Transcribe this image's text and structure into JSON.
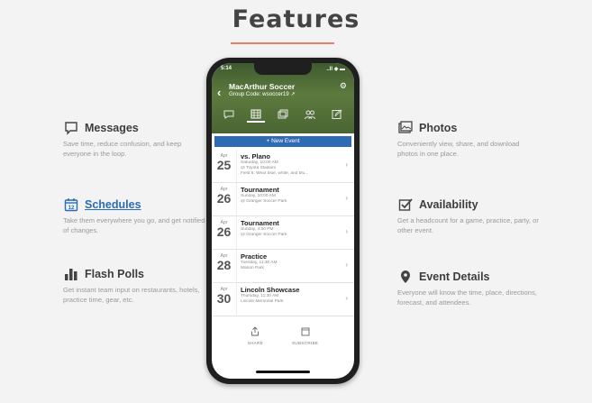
{
  "page": {
    "title": "Features"
  },
  "features_left": [
    {
      "name": "messages",
      "icon": "chat-bubble-icon",
      "label": "Messages",
      "desc": "Save time, reduce confusion, and keep everyone in the loop."
    },
    {
      "name": "schedules",
      "icon": "calendar-icon",
      "label": "Schedules",
      "desc": "Take them everywhere you go, and get notified of changes.",
      "active": true
    },
    {
      "name": "flash-polls",
      "icon": "bar-chart-icon",
      "label": "Flash Polls",
      "desc": "Get instant team input on restaurants, hotels, practice time, gear, etc."
    }
  ],
  "features_right": [
    {
      "name": "photos",
      "icon": "photos-icon",
      "label": "Photos",
      "desc": "Conveniently view, share, and download photos in one place."
    },
    {
      "name": "availability",
      "icon": "checkbox-icon",
      "label": "Availability",
      "desc": "Get a headcount for a game, practice, party, or other event."
    },
    {
      "name": "event-details",
      "icon": "map-pin-icon",
      "label": "Event Details",
      "desc": "Everyone will know the time, place, directions, forecast, and attendees."
    }
  ],
  "phone": {
    "time": "5:14",
    "signal": "..ll ◈ ▬",
    "group_name": "MacArthur Soccer",
    "group_code": "Group Code: wsoccer19 ↗",
    "new_event": "+ New Event",
    "events": [
      {
        "month": "Apr",
        "day": "25",
        "name": "vs. Plano",
        "lines": [
          "Saturday, 10:00 AM",
          "@ Toyota Stadium",
          "Field 8, Wear blue, white, and blu..."
        ]
      },
      {
        "month": "Apr",
        "day": "26",
        "name": "Tournament",
        "lines": [
          "Sunday, 10:00 AM",
          "@ Granger Soccer Park"
        ]
      },
      {
        "month": "Apr",
        "day": "26",
        "name": "Tournament",
        "lines": [
          "Sunday, 4:00 PM",
          "@ Granger Soccer Park"
        ]
      },
      {
        "month": "Apr",
        "day": "28",
        "name": "Practice",
        "lines": [
          "Tuesday, 11:30 AM",
          "Marion Park"
        ]
      },
      {
        "month": "Apr",
        "day": "30",
        "name": "Lincoln Showcase",
        "lines": [
          "Thursday, 11:30 AM",
          "Lincoln Memorial Park"
        ]
      }
    ],
    "actions": [
      {
        "label": "SHARE",
        "icon": "share-icon"
      },
      {
        "label": "SUBSCRIBE",
        "icon": "calendar-subscribe-icon"
      }
    ]
  },
  "colors": {
    "accent": "#2f6bb3",
    "rule": "#e8826e",
    "header_green": "#4a6532"
  }
}
